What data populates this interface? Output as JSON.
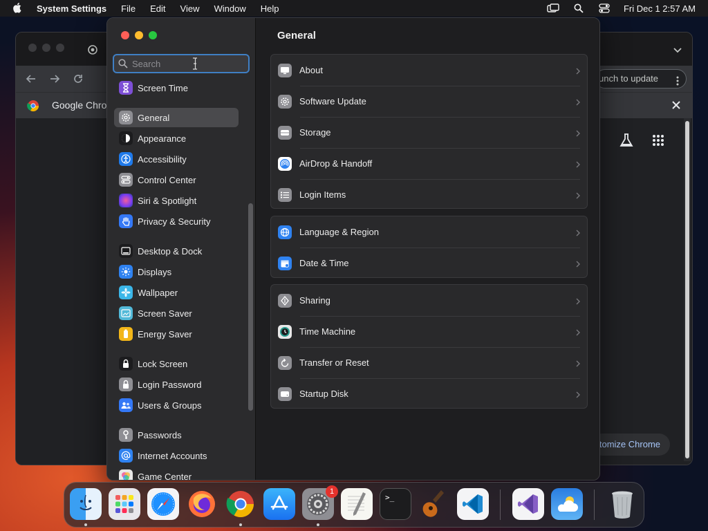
{
  "menubar": {
    "app_name": "System Settings",
    "menus": [
      "File",
      "Edit",
      "View",
      "Window",
      "Help"
    ],
    "clock": "Fri Dec 1  2:57 AM"
  },
  "chrome_window": {
    "tab_label_partial": "I",
    "omnibox_right_text": "unch to update",
    "infobar_title": "Google Chron",
    "customize_button": "tomize Chrome"
  },
  "settings": {
    "search": {
      "placeholder": "Search",
      "value": ""
    },
    "sidebar_items": [
      {
        "label": "Screen Time",
        "icon": "hourglass-icon",
        "color": "#7d4fd6"
      },
      {
        "label": "General",
        "icon": "gear-icon",
        "color": "#8e8e93",
        "active": true
      },
      {
        "label": "Appearance",
        "icon": "appearance-icon",
        "color": "#1c1c1e"
      },
      {
        "label": "Accessibility",
        "icon": "accessibility-icon",
        "color": "#1f7aeb"
      },
      {
        "label": "Control Center",
        "icon": "control-center-icon",
        "color": "#8e8e93"
      },
      {
        "label": "Siri & Spotlight",
        "icon": "siri-icon",
        "color": "#b43ad6"
      },
      {
        "label": "Privacy & Security",
        "icon": "hand-icon",
        "color": "#3478f6"
      },
      {
        "label": "Desktop & Dock",
        "icon": "dock-icon",
        "color": "#1c1c1e"
      },
      {
        "label": "Displays",
        "icon": "sun-icon",
        "color": "#2f82f0"
      },
      {
        "label": "Wallpaper",
        "icon": "flower-icon",
        "color": "#3bb6e8"
      },
      {
        "label": "Screen Saver",
        "icon": "screen-saver-icon",
        "color": "#52b9d8"
      },
      {
        "label": "Energy Saver",
        "icon": "battery-icon",
        "color": "#f2b619"
      },
      {
        "label": "Lock Screen",
        "icon": "lock-icon",
        "color": "#1c1c1e"
      },
      {
        "label": "Login Password",
        "icon": "lock-icon",
        "color": "#8e8e93"
      },
      {
        "label": "Users & Groups",
        "icon": "users-icon",
        "color": "#3478f6"
      },
      {
        "label": "Passwords",
        "icon": "key-icon",
        "color": "#8e8e93"
      },
      {
        "label": "Internet Accounts",
        "icon": "at-icon",
        "color": "#2f82f0"
      },
      {
        "label": "Game Center",
        "icon": "game-center-icon",
        "color": "#e8e8e8"
      }
    ],
    "main": {
      "title": "General",
      "groups": [
        [
          {
            "label": "About",
            "icon": "display-icon",
            "color": "#8e8e93"
          },
          {
            "label": "Software Update",
            "icon": "gear-badge-icon",
            "color": "#8e8e93"
          },
          {
            "label": "Storage",
            "icon": "storage-icon",
            "color": "#8e8e93"
          },
          {
            "label": "AirDrop & Handoff",
            "icon": "airdrop-icon",
            "color": "#2f82f0"
          },
          {
            "label": "Login Items",
            "icon": "list-icon",
            "color": "#8e8e93"
          }
        ],
        [
          {
            "label": "Language & Region",
            "icon": "globe-icon",
            "color": "#2f82f0"
          },
          {
            "label": "Date & Time",
            "icon": "calendar-icon",
            "color": "#2f82f0"
          }
        ],
        [
          {
            "label": "Sharing",
            "icon": "sharing-icon",
            "color": "#8e8e93"
          },
          {
            "label": "Time Machine",
            "icon": "time-machine-icon",
            "color": "#2a9d8f"
          },
          {
            "label": "Transfer or Reset",
            "icon": "reset-icon",
            "color": "#8e8e93"
          },
          {
            "label": "Startup Disk",
            "icon": "disk-icon",
            "color": "#8e8e93"
          }
        ]
      ]
    }
  },
  "dock": {
    "apps": [
      {
        "name": "Finder",
        "icon": "finder-icon",
        "running": true
      },
      {
        "name": "Launchpad",
        "icon": "launchpad-icon"
      },
      {
        "name": "Safari",
        "icon": "safari-icon"
      },
      {
        "name": "Firefox",
        "icon": "firefox-icon"
      },
      {
        "name": "Google Chrome",
        "icon": "chrome-icon",
        "running": true
      },
      {
        "name": "App Store",
        "icon": "app-store-icon"
      },
      {
        "name": "System Settings",
        "icon": "system-settings-icon",
        "running": true,
        "badge": "1"
      },
      {
        "name": "TextEdit",
        "icon": "textedit-icon"
      },
      {
        "name": "Terminal",
        "icon": "terminal-icon",
        "prompt": ">_"
      },
      {
        "name": "GarageBand",
        "icon": "guitar-icon"
      },
      {
        "name": "Visual Studio Code",
        "icon": "vscode-icon"
      },
      {
        "name": "Visual Studio",
        "icon": "visual-studio-icon"
      },
      {
        "name": "Weather",
        "icon": "weather-icon"
      },
      {
        "name": "Trash",
        "icon": "trash-icon"
      }
    ]
  }
}
